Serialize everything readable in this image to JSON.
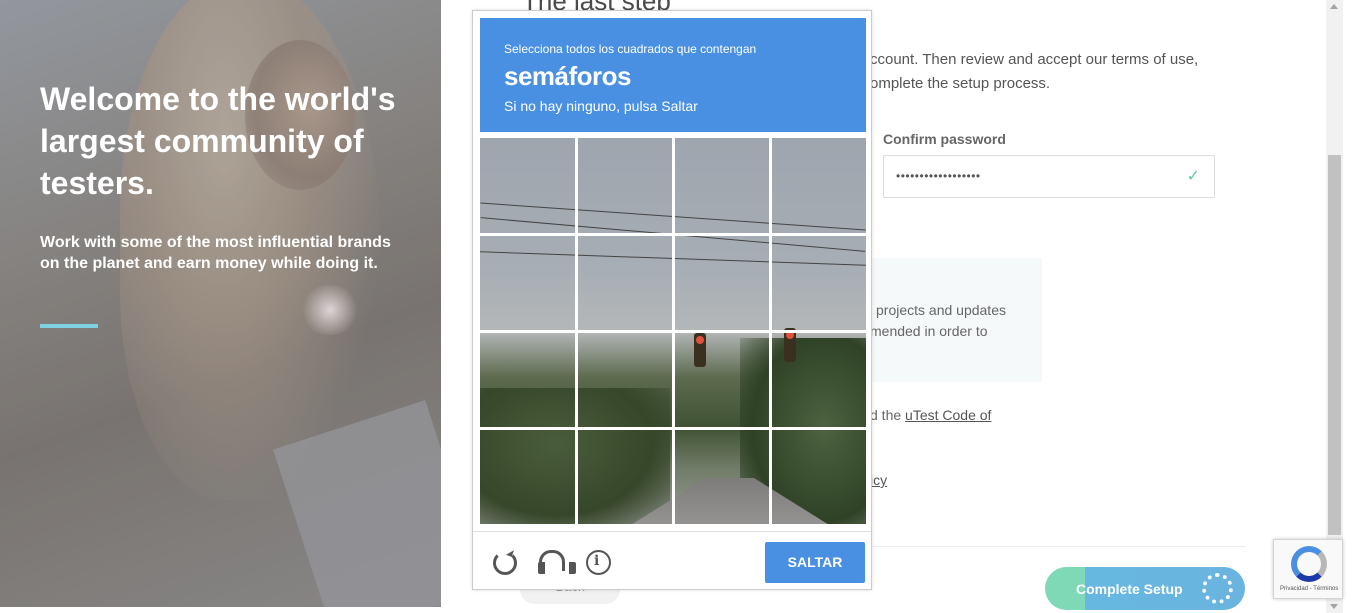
{
  "hero": {
    "title": "Welcome to the world's largest community of testers.",
    "subtitle": "Work with some of the most influential brands on the planet and earn money while doing it."
  },
  "form": {
    "title": "The last step",
    "intro_line1": "ccount. Then review and accept our terms of use,",
    "intro_line2": "omplete the setup process.",
    "confirm_password_label": "Confirm password",
    "confirm_password_value": "••••••••••••••••••",
    "notice_line1": "projects and updates",
    "notice_line2": "mended in order to",
    "terms_prefix": "d the ",
    "terms_link": "uTest Code of",
    "policy_link": "icy",
    "back_label": "Back",
    "complete_label": "Complete Setup"
  },
  "captcha": {
    "instruction": "Selecciona todos los cuadrados que contengan",
    "target": "semáforos",
    "hint": "Si no hay ninguno, pulsa Saltar",
    "skip_label": "SALTAR",
    "grid_rows": 4,
    "grid_cols": 4
  },
  "badge": {
    "footer": "Privacidad - Términos"
  },
  "colors": {
    "captcha_blue": "#4a90e2",
    "hero_rule": "#7fd0e0",
    "check_green": "#5fc9a8"
  }
}
